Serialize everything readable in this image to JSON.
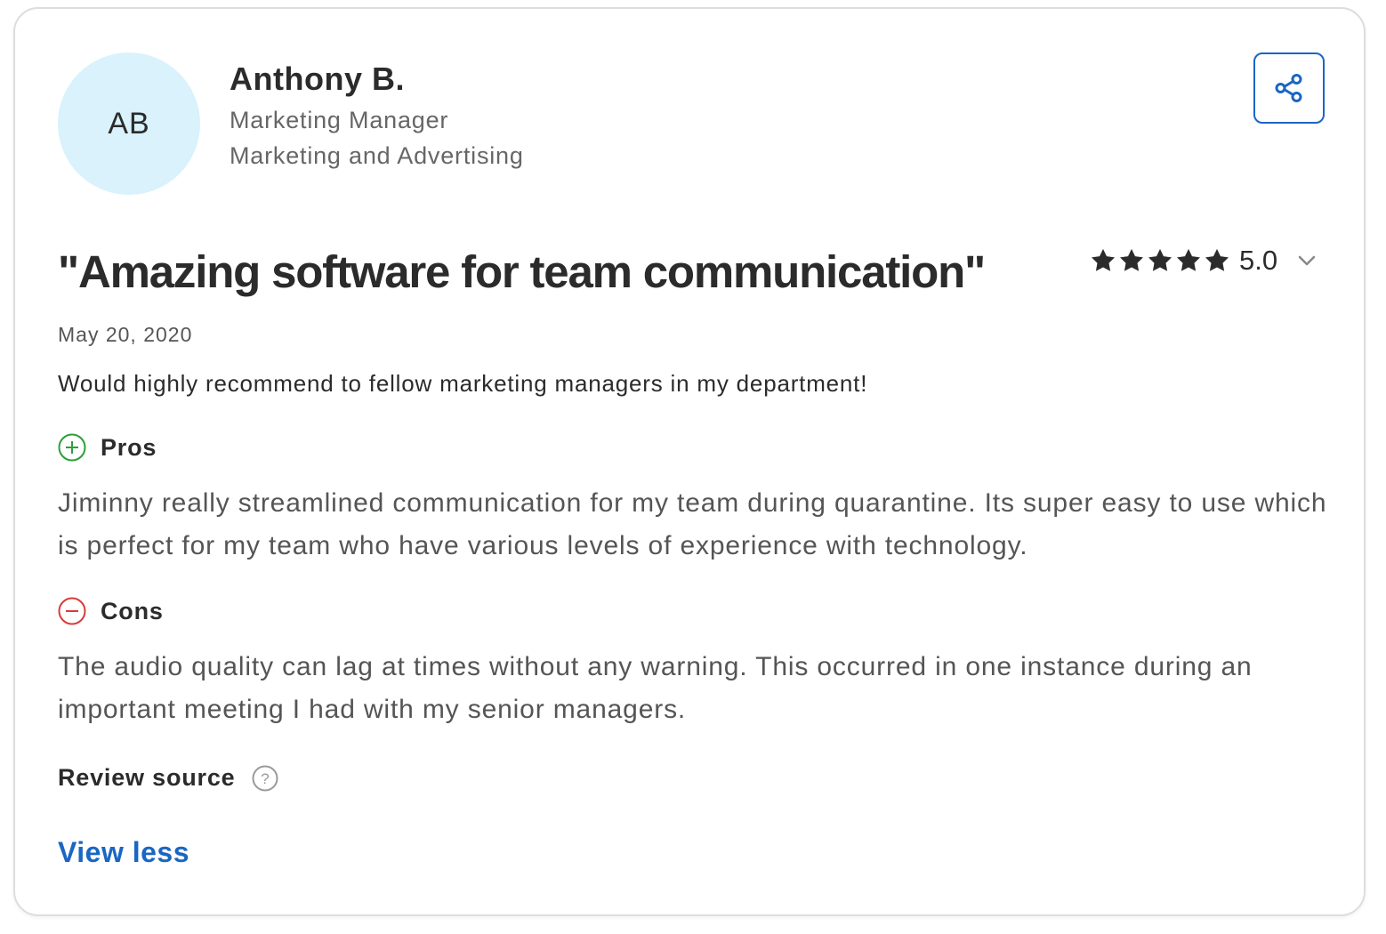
{
  "reviewer": {
    "initials": "AB",
    "name": "Anthony B.",
    "role": "Marketing Manager",
    "industry": "Marketing and Advertising"
  },
  "review": {
    "title": "\"Amazing software for team communication\"",
    "rating": {
      "stars_filled": 5,
      "stars_total": 5,
      "value_label": "5.0"
    },
    "date": "May 20, 2020",
    "summary": "Would highly recommend to fellow marketing managers in my department!",
    "pros": {
      "label": "Pros",
      "text": "Jiminny really streamlined communication for my team during quarantine. Its super easy to use which is perfect for my team who have various levels of experience with technology."
    },
    "cons": {
      "label": "Cons",
      "text": "The audio quality can lag at times without any warning. This occurred in one instance during an important meeting I had with my senior managers."
    },
    "source_label": "Review source",
    "view_less_label": "View less"
  },
  "icons": {
    "share": "share-icon",
    "star": "star-icon",
    "chevron": "chevron-down-icon",
    "plus": "plus-circle-icon",
    "minus": "minus-circle-icon",
    "help": "question-circle-icon"
  },
  "colors": {
    "accent": "#1a66c4",
    "avatar_bg": "#d9f2fc",
    "pros": "#2e9e3a",
    "cons": "#d93b3b",
    "star": "#2b2b2b",
    "border": "#dddddd"
  }
}
